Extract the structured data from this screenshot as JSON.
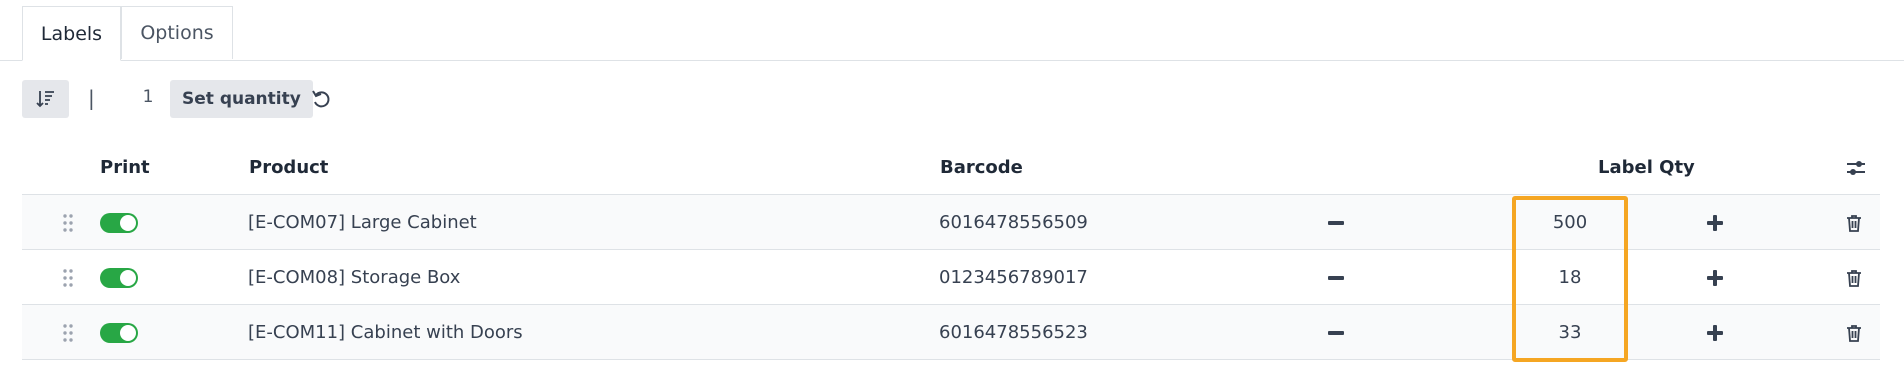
{
  "tabs": [
    {
      "label": "Labels",
      "active": true
    },
    {
      "label": "Options",
      "active": false
    }
  ],
  "toolbar": {
    "separator": "|",
    "quantity_value": "1",
    "set_quantity_label": "Set quantity",
    "sort_icon": "sort-icon",
    "reset_icon": "reset-icon"
  },
  "table": {
    "headers": {
      "print": "Print",
      "product": "Product",
      "barcode": "Barcode",
      "label_qty": "Label Qty"
    },
    "settings_icon": "column-settings-icon",
    "rows": [
      {
        "product": "[E-COM07] Large Cabinet",
        "barcode": "6016478556509",
        "qty": "500",
        "print": true
      },
      {
        "product": "[E-COM08] Storage Box",
        "barcode": "0123456789017",
        "qty": "18",
        "print": true
      },
      {
        "product": "[E-COM11] Cabinet with Doors",
        "barcode": "6016478556523",
        "qty": "33",
        "print": true
      }
    ]
  },
  "colors": {
    "toggle_on": "#28a745",
    "highlight": "#f5a623",
    "button_bg": "#e5e7eb"
  }
}
